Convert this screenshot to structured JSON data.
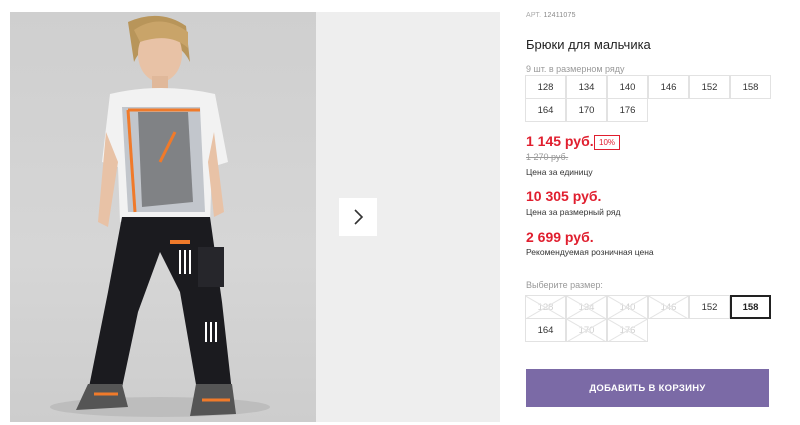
{
  "product": {
    "art_label": "АРТ.",
    "art_number": "12411075",
    "title": "Брюки для мальчика",
    "size_row_info": "9 шт. в размерном ряду",
    "size_row": [
      "128",
      "134",
      "140",
      "146",
      "152",
      "158",
      "164",
      "170",
      "176"
    ],
    "price_unit": "1 145 руб.",
    "discount": "10%",
    "old_price": "1 270 руб.",
    "price_unit_caption": "Цена за единицу",
    "price_row": "10 305 руб.",
    "price_row_caption": "Цена за размерный ряд",
    "price_retail": "2 699 руб.",
    "price_retail_caption": "Рекомендуемая розничная цена",
    "choose_size_label": "Выберите размер:",
    "size_options": [
      {
        "label": "128",
        "available": false
      },
      {
        "label": "134",
        "available": false
      },
      {
        "label": "140",
        "available": false
      },
      {
        "label": "146",
        "available": false
      },
      {
        "label": "152",
        "available": true
      },
      {
        "label": "158",
        "available": true,
        "selected": true
      },
      {
        "label": "164",
        "available": true
      },
      {
        "label": "170",
        "available": false
      },
      {
        "label": "176",
        "available": false
      }
    ],
    "add_to_cart": "ДОБАВИТЬ В КОРЗИНУ"
  },
  "colors": {
    "price_red": "#e01e2e",
    "button_purple": "#7b6aa6"
  },
  "icons": {
    "next": "chevron-right-icon"
  }
}
